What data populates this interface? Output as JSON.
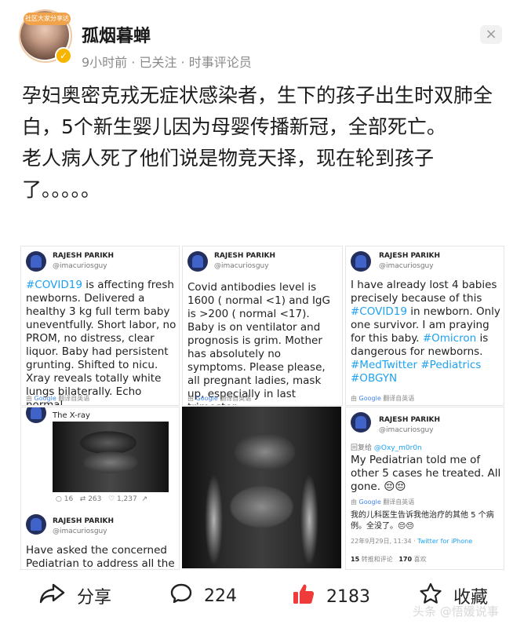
{
  "header": {
    "avatar_banner": "社区大家分享达人",
    "username": "孤烟暮蝉",
    "meta": "9小时前 · 已关注 · 时事评论员",
    "close_icon": "close-icon"
  },
  "post": {
    "line1": "孕妇奥密克戎无症状感染者，生下的孩子出生时双肺全白，5个新生婴儿因为母婴传播新冠，全部死亡。",
    "line2": "老人病人死了他们说是物竞天择，现在轮到孩子了。。。。。"
  },
  "tweets": {
    "author": "RAJESH PARIKH",
    "handle": "@imacuriosguy",
    "translate_prefix": "由",
    "translate_google": "Google",
    "translate_suffix": "翻译自英语",
    "card1": {
      "hashtag": "#COVID19",
      "text": " is affecting fresh newborns. Delivered a healthy 3 kg full term baby uneventfully. Short labor, no PROM, no distress, clear liquor. Baby had persistent grunting. Shifted to nicu. Xray reveals totally white lungs bilaterally. Echo normal…"
    },
    "card2": {
      "text": "Covid antibodies level is 1600 ( normal <1) and IgG is >200 ( normal <17). Baby is on ventilator and prognosis is grim. Mother has absolutely no symptoms. Please please, all pregnant ladies, mask up, especially in last trimester. .."
    },
    "card3": {
      "text1": "I have already lost 4 babies precisely because of this ",
      "hashtag1": "#COVID19",
      "text2": " in newborn. Only one survivor. I am praying for this baby.",
      "hashtag2": "#Omicron",
      "text3": " is dangerous for newborns.",
      "hashtags": "#MedTwitter #Pediatrics #OBGYN"
    },
    "card4": {
      "caption": "The X-ray",
      "stats": [
        "16",
        "263",
        "1,237"
      ],
      "text": "Have asked the concerned Pediatrian to address all the"
    },
    "card6": {
      "reply_prefix": "回复给",
      "reply_handle": "@Oxy_m0r0n",
      "text": "My Pediatrian told me of other 5 cases he treated. All gone.",
      "emoji": "😔😔",
      "translation": "我的儿科医生告诉我他治疗的其他 5 个病例。全没了。😔😔",
      "date": "22年9月29日, 11:34 · ",
      "via": "Twitter for iPhone",
      "retweets_count": "15",
      "retweets_label": "转推和评论",
      "likes_count": "170",
      "likes_label": "喜欢"
    }
  },
  "actions": {
    "share_label": "分享",
    "comment_count": "224",
    "like_count": "2183",
    "favorite_label": "收藏"
  },
  "watermark": "头条 @悟媛说事"
}
